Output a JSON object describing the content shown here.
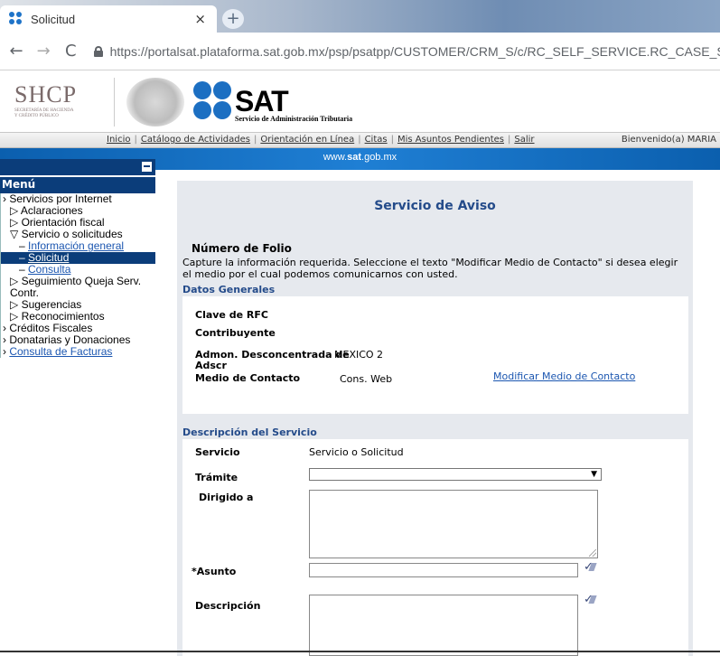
{
  "browser": {
    "tab_title": "Solicitud",
    "tab_close": "×",
    "new_tab": "+",
    "url_domain": "https://portalsat.plataforma.sat.gob.mx",
    "url_path": "/psp/psatpp/CUSTOMER/CRM_S/c/RC_SELF_SERVICE.RC_CASE_SW_SS_",
    "back": "←",
    "forward": "→",
    "reload": "C"
  },
  "header": {
    "shcp": "SHCP",
    "shcp_sub1": "SECRETARÍA DE HACIENDA",
    "shcp_sub2": "Y CRÉDITO PÚBLICO",
    "sat": "SAT",
    "sat_sub": "Servicio de Administración Tributaria"
  },
  "topmenu": {
    "links": [
      "Inicio",
      "Catálogo de Actividades",
      "Orientación en Línea",
      "Citas",
      "Mis Asuntos Pendientes",
      "Salir"
    ],
    "welcome": "Bienvenido(a) MARIA"
  },
  "bluebar": {
    "text_pre": "www.",
    "text_bold": "sat",
    "text_post": ".gob.mx"
  },
  "menu": {
    "title": "Menú",
    "items": [
      {
        "label": "› Servicios por Internet"
      },
      {
        "label": "▷ Aclaraciones"
      },
      {
        "label": "▷ Orientación fiscal"
      },
      {
        "label": "▽ Servicio o solicitudes"
      },
      {
        "label": "Información general"
      },
      {
        "label": "Solicitud"
      },
      {
        "label": "Consulta"
      },
      {
        "label": "▷ Seguimiento Queja Serv. Contr."
      },
      {
        "label": "▷ Sugerencias"
      },
      {
        "label": "▷ Reconocimientos"
      },
      {
        "label": "› Créditos Fiscales"
      },
      {
        "label": "› Donatarias y Donaciones"
      },
      {
        "label": "Consulta de Facturas"
      }
    ]
  },
  "form": {
    "title": "Servicio de Aviso",
    "folio_label": "Número de Folio",
    "instructions": "Capture la información requerida. Seleccione el texto \"Modificar Medio de Contacto\" si desea elegir el medio por el cual podemos comunicarnos con usted.",
    "datos_generales": "Datos Generales",
    "clave_rfc": "Clave de RFC",
    "contribuyente": "Contribuyente",
    "admon_label_1": "Admon. Desconcentrada de",
    "admon_label_2": "Adscr",
    "admon_value": "MEXICO 2",
    "medio_label": "Medio de Contacto",
    "medio_value": "Cons. Web",
    "modificar_link": "Modificar Medio de Contacto",
    "descripcion_servicio": "Descripción del Servicio",
    "servicio_label": "Servicio",
    "servicio_value": "Servicio o Solicitud",
    "tramite_label": "Trámite",
    "tramite_value": "",
    "dirigido_label": "Dirigido a",
    "asunto_label": "*Asunto",
    "descripcion_label": "Descripción"
  }
}
